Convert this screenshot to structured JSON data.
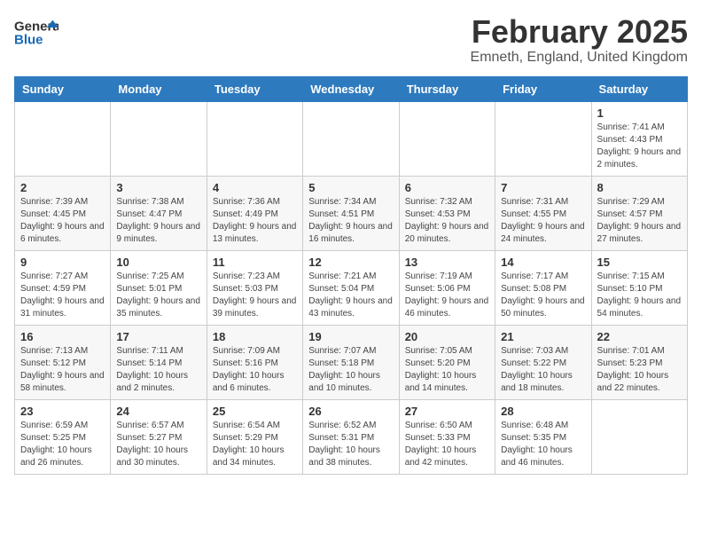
{
  "header": {
    "logo_general": "General",
    "logo_blue": "Blue",
    "month_title": "February 2025",
    "location": "Emneth, England, United Kingdom"
  },
  "weekdays": [
    "Sunday",
    "Monday",
    "Tuesday",
    "Wednesday",
    "Thursday",
    "Friday",
    "Saturday"
  ],
  "weeks": [
    [
      {
        "day": "",
        "info": ""
      },
      {
        "day": "",
        "info": ""
      },
      {
        "day": "",
        "info": ""
      },
      {
        "day": "",
        "info": ""
      },
      {
        "day": "",
        "info": ""
      },
      {
        "day": "",
        "info": ""
      },
      {
        "day": "1",
        "info": "Sunrise: 7:41 AM\nSunset: 4:43 PM\nDaylight: 9 hours and 2 minutes."
      }
    ],
    [
      {
        "day": "2",
        "info": "Sunrise: 7:39 AM\nSunset: 4:45 PM\nDaylight: 9 hours and 6 minutes."
      },
      {
        "day": "3",
        "info": "Sunrise: 7:38 AM\nSunset: 4:47 PM\nDaylight: 9 hours and 9 minutes."
      },
      {
        "day": "4",
        "info": "Sunrise: 7:36 AM\nSunset: 4:49 PM\nDaylight: 9 hours and 13 minutes."
      },
      {
        "day": "5",
        "info": "Sunrise: 7:34 AM\nSunset: 4:51 PM\nDaylight: 9 hours and 16 minutes."
      },
      {
        "day": "6",
        "info": "Sunrise: 7:32 AM\nSunset: 4:53 PM\nDaylight: 9 hours and 20 minutes."
      },
      {
        "day": "7",
        "info": "Sunrise: 7:31 AM\nSunset: 4:55 PM\nDaylight: 9 hours and 24 minutes."
      },
      {
        "day": "8",
        "info": "Sunrise: 7:29 AM\nSunset: 4:57 PM\nDaylight: 9 hours and 27 minutes."
      }
    ],
    [
      {
        "day": "9",
        "info": "Sunrise: 7:27 AM\nSunset: 4:59 PM\nDaylight: 9 hours and 31 minutes."
      },
      {
        "day": "10",
        "info": "Sunrise: 7:25 AM\nSunset: 5:01 PM\nDaylight: 9 hours and 35 minutes."
      },
      {
        "day": "11",
        "info": "Sunrise: 7:23 AM\nSunset: 5:03 PM\nDaylight: 9 hours and 39 minutes."
      },
      {
        "day": "12",
        "info": "Sunrise: 7:21 AM\nSunset: 5:04 PM\nDaylight: 9 hours and 43 minutes."
      },
      {
        "day": "13",
        "info": "Sunrise: 7:19 AM\nSunset: 5:06 PM\nDaylight: 9 hours and 46 minutes."
      },
      {
        "day": "14",
        "info": "Sunrise: 7:17 AM\nSunset: 5:08 PM\nDaylight: 9 hours and 50 minutes."
      },
      {
        "day": "15",
        "info": "Sunrise: 7:15 AM\nSunset: 5:10 PM\nDaylight: 9 hours and 54 minutes."
      }
    ],
    [
      {
        "day": "16",
        "info": "Sunrise: 7:13 AM\nSunset: 5:12 PM\nDaylight: 9 hours and 58 minutes."
      },
      {
        "day": "17",
        "info": "Sunrise: 7:11 AM\nSunset: 5:14 PM\nDaylight: 10 hours and 2 minutes."
      },
      {
        "day": "18",
        "info": "Sunrise: 7:09 AM\nSunset: 5:16 PM\nDaylight: 10 hours and 6 minutes."
      },
      {
        "day": "19",
        "info": "Sunrise: 7:07 AM\nSunset: 5:18 PM\nDaylight: 10 hours and 10 minutes."
      },
      {
        "day": "20",
        "info": "Sunrise: 7:05 AM\nSunset: 5:20 PM\nDaylight: 10 hours and 14 minutes."
      },
      {
        "day": "21",
        "info": "Sunrise: 7:03 AM\nSunset: 5:22 PM\nDaylight: 10 hours and 18 minutes."
      },
      {
        "day": "22",
        "info": "Sunrise: 7:01 AM\nSunset: 5:23 PM\nDaylight: 10 hours and 22 minutes."
      }
    ],
    [
      {
        "day": "23",
        "info": "Sunrise: 6:59 AM\nSunset: 5:25 PM\nDaylight: 10 hours and 26 minutes."
      },
      {
        "day": "24",
        "info": "Sunrise: 6:57 AM\nSunset: 5:27 PM\nDaylight: 10 hours and 30 minutes."
      },
      {
        "day": "25",
        "info": "Sunrise: 6:54 AM\nSunset: 5:29 PM\nDaylight: 10 hours and 34 minutes."
      },
      {
        "day": "26",
        "info": "Sunrise: 6:52 AM\nSunset: 5:31 PM\nDaylight: 10 hours and 38 minutes."
      },
      {
        "day": "27",
        "info": "Sunrise: 6:50 AM\nSunset: 5:33 PM\nDaylight: 10 hours and 42 minutes."
      },
      {
        "day": "28",
        "info": "Sunrise: 6:48 AM\nSunset: 5:35 PM\nDaylight: 10 hours and 46 minutes."
      },
      {
        "day": "",
        "info": ""
      }
    ]
  ]
}
